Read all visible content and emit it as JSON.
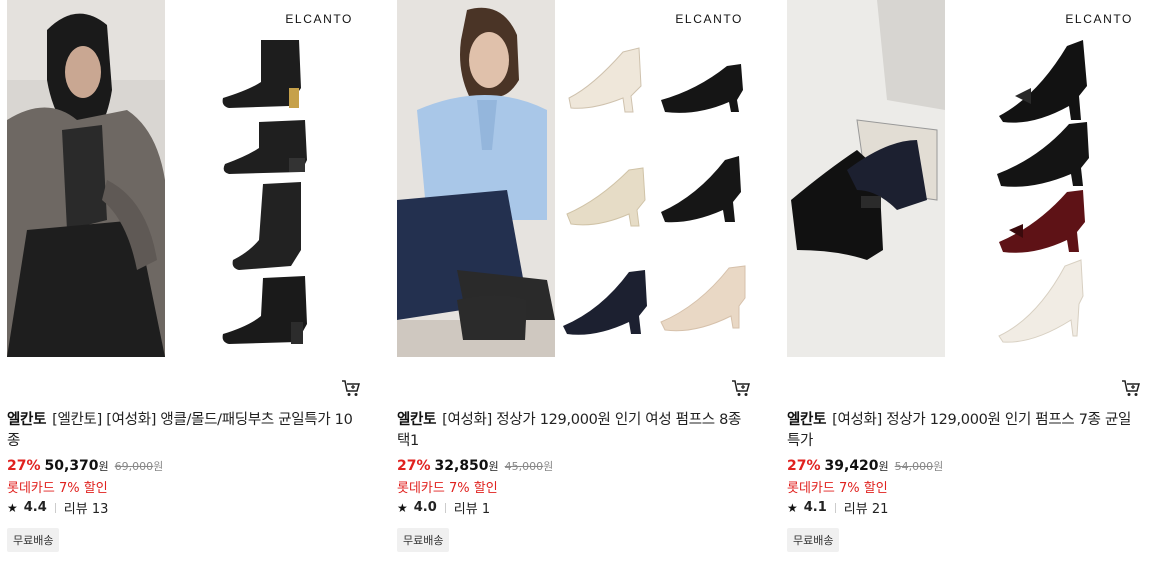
{
  "products": [
    {
      "brand_mark": "ELCANTO",
      "brand": "엘칸토",
      "name": "[엘칸토] [여성화] 앵클/몰드/패딩부츠 균일특가 10종",
      "discount": "27%",
      "price": "50,370",
      "currency": "원",
      "original_price": "69,000",
      "promo": "롯데카드 7% 할인",
      "rating": "4.4",
      "review_label": "리뷰 13",
      "badge": "무료배송",
      "image_icon": "ankle-boots-photo"
    },
    {
      "brand_mark": "ELCANTO",
      "brand": "엘칸토",
      "name": "[여성화] 정상가 129,000원 인기 여성 펌프스 8종 택1",
      "discount": "27%",
      "price": "32,850",
      "currency": "원",
      "original_price": "45,000",
      "promo": "롯데카드 7% 할인",
      "rating": "4.0",
      "review_label": "리뷰 1",
      "badge": "무료배송",
      "image_icon": "pumps-photo"
    },
    {
      "brand_mark": "ELCANTO",
      "brand": "엘칸토",
      "name": "[여성화] 정상가 129,000원 인기 펌프스 7종 균일특가",
      "discount": "27%",
      "price": "39,420",
      "currency": "원",
      "original_price": "54,000",
      "promo": "롯데카드 7% 할인",
      "rating": "4.1",
      "review_label": "리뷰 21",
      "badge": "무료배송",
      "image_icon": "heels-photo"
    }
  ],
  "colors": {
    "discount": "#e0221f",
    "promo": "#e0221f",
    "badge_bg": "#f0f0f0"
  }
}
